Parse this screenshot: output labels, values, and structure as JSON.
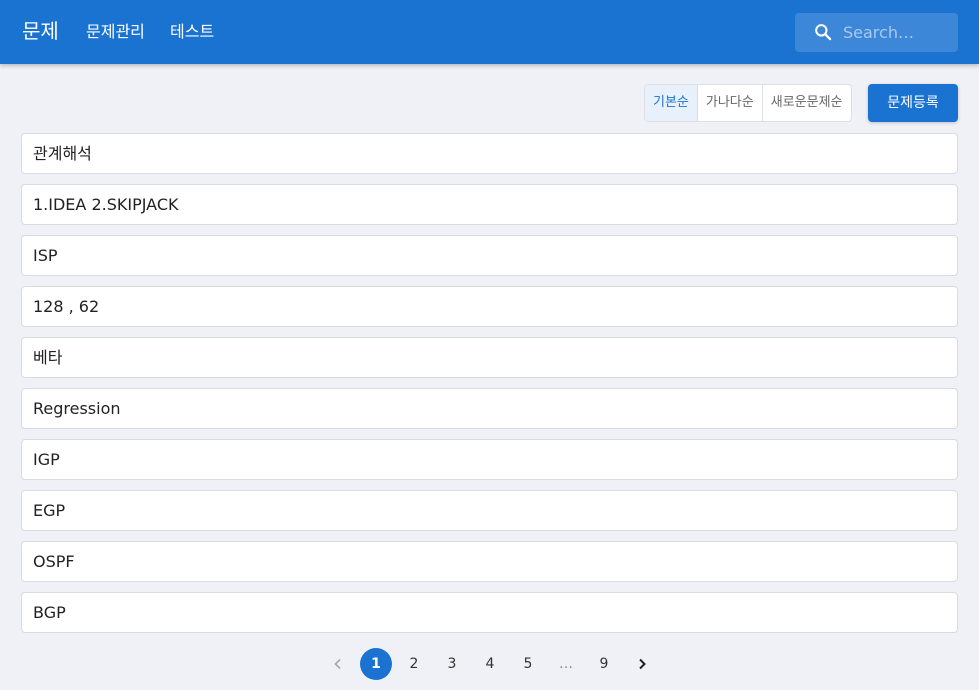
{
  "appbar": {
    "brand": "문제",
    "nav": [
      {
        "label": "문제관리"
      },
      {
        "label": "테스트"
      }
    ],
    "search": {
      "placeholder": "Search…",
      "value": ""
    }
  },
  "toolbar": {
    "sort_options": [
      {
        "label": "기본순",
        "active": true
      },
      {
        "label": "가나다순",
        "active": false
      },
      {
        "label": "새로운문제순",
        "active": false
      }
    ],
    "register_label": "문제등록"
  },
  "questions": [
    {
      "text": "관계해석"
    },
    {
      "text": "1.IDEA 2.SKIPJACK"
    },
    {
      "text": "ISP"
    },
    {
      "text": "128 , 62"
    },
    {
      "text": "베타"
    },
    {
      "text": "Regression"
    },
    {
      "text": "IGP"
    },
    {
      "text": "EGP"
    },
    {
      "text": "OSPF"
    },
    {
      "text": "BGP"
    }
  ],
  "pagination": {
    "current": 1,
    "pages": [
      "1",
      "2",
      "3",
      "4",
      "5",
      "…",
      "9"
    ],
    "prev_icon": "chevron-left-icon",
    "next_icon": "chevron-right-icon"
  },
  "colors": {
    "primary": "#1a73d1",
    "background": "#f0f1f6",
    "card_border": "#d8dbe2"
  }
}
